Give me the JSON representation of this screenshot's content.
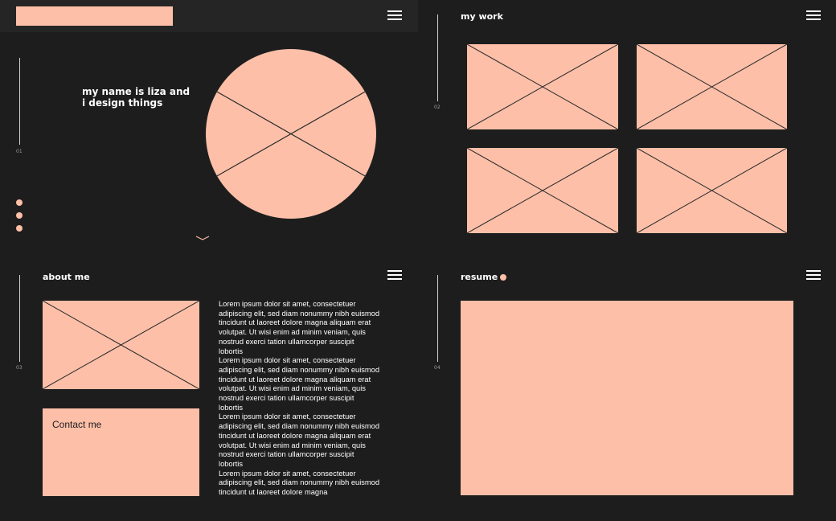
{
  "hero": {
    "title": "my name is liza and i design things",
    "section_number": "01"
  },
  "work": {
    "title": "my work",
    "section_number": "02"
  },
  "about": {
    "title": "about me",
    "section_number": "03",
    "paragraphs": [
      "Lorem ipsum dolor sit amet, consectetuer adipiscing elit, sed diam nonummy nibh euismod tincidunt ut laoreet dolore magna aliquam erat volutpat. Ut wisi enim ad minim veniam, quis nostrud exerci tation ullamcorper suscipit lobortis",
      "Lorem ipsum dolor sit amet, consectetuer adipiscing elit, sed diam nonummy nibh euismod tincidunt ut laoreet dolore magna aliquam erat volutpat. Ut wisi enim ad minim veniam, quis nostrud exerci tation ullamcorper suscipit lobortis",
      "Lorem ipsum dolor sit amet, consectetuer adipiscing elit, sed diam nonummy nibh euismod tincidunt ut laoreet dolore magna aliquam erat volutpat. Ut wisi enim ad minim veniam, quis nostrud exerci tation ullamcorper suscipit lobortis",
      "Lorem ipsum dolor sit amet, consectetuer adipiscing elit, sed diam nonummy nibh euismod tincidunt ut laoreet dolore magna"
    ],
    "contact_label": "Contact me"
  },
  "resume": {
    "title": "resume",
    "section_number": "04"
  },
  "icons": {
    "menu": "hamburger-menu-icon",
    "scroll": "chevron-down-icon",
    "placeholder": "image-placeholder-icon"
  },
  "colors": {
    "background": "#1d1d1d",
    "header": "#252525",
    "accent": "#fdbfa8",
    "text": "#ffffff"
  }
}
